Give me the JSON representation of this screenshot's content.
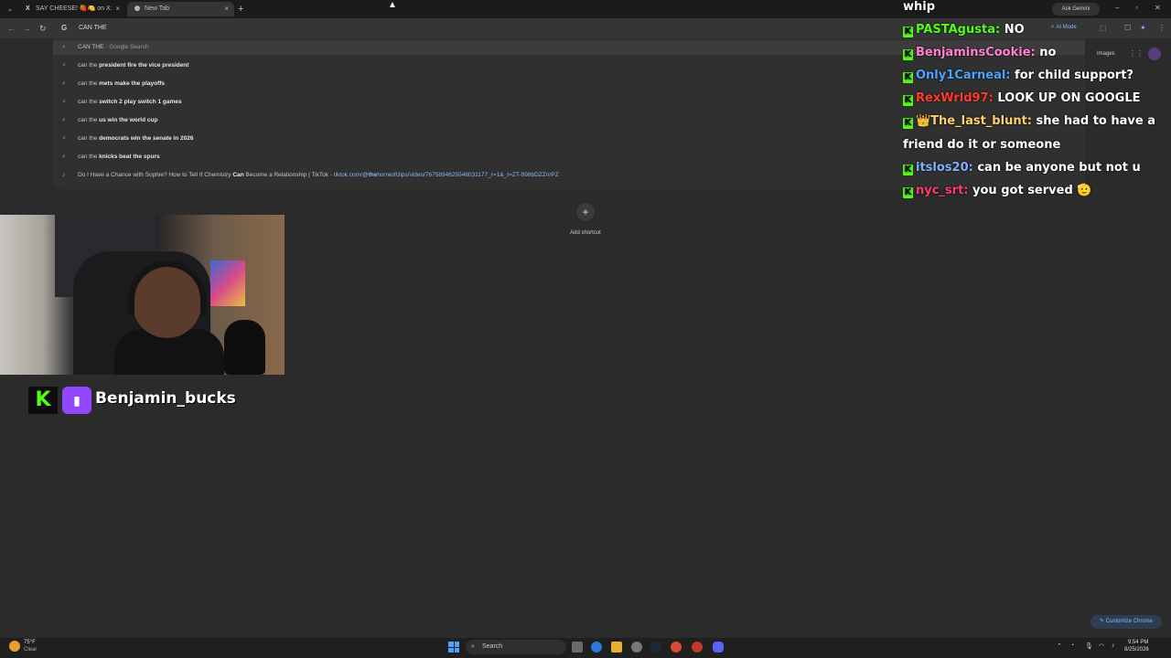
{
  "browser": {
    "tabs": [
      {
        "label": "SAY CHEESE! 🍓🍋 on X: \"Anti",
        "icon": "X",
        "active": false
      },
      {
        "label": "New Tab",
        "icon": "◍",
        "active": true
      }
    ],
    "ask_gemini": "Ask Gemini",
    "omnibox": {
      "text": "CAN THE",
      "ai_mode": "AI Mode"
    },
    "suggestions": [
      {
        "prefix": "CAN THE",
        "bold": "",
        "suffix": " - Google Search",
        "type": "search"
      },
      {
        "prefix": "can the ",
        "bold": "president fire the vice president",
        "suffix": "",
        "type": "search"
      },
      {
        "prefix": "can the ",
        "bold": "mets make the playoffs",
        "suffix": "",
        "type": "search"
      },
      {
        "prefix": "can the ",
        "bold": "switch 2 play switch 1 games",
        "suffix": "",
        "type": "search"
      },
      {
        "prefix": "can the ",
        "bold": "us win the world cup",
        "suffix": "",
        "type": "search"
      },
      {
        "prefix": "can the ",
        "bold": "democrats win the senate in 2026",
        "suffix": "",
        "type": "search"
      },
      {
        "prefix": "can the ",
        "bold": "knicks beat the spurs",
        "suffix": "",
        "type": "search"
      }
    ],
    "tiktok_suggestion": {
      "title_a": "Do I Have a Chance with Sophie? How to Tell If Chemistry ",
      "title_bold": "Can",
      "title_b": " Become a Relationship | TikTok",
      "sep": " - ",
      "url_a": "tiktok.com/@",
      "url_bold": "the",
      "url_b": "horreofclips/video/7675894625546031177_r=1&_t=ZT-998bDZZnrPZ"
    },
    "images_link": "Images",
    "add_shortcut": "Add shortcut",
    "customize": "Customize Chrome"
  },
  "chat": [
    {
      "user": "",
      "text": "whip",
      "color": "#ffffff",
      "badge": false
    },
    {
      "user": "PASTAgusta:",
      "text": " NO",
      "color": "#53fc18",
      "badge": true
    },
    {
      "user": "BenjaminsCookie:",
      "text": " no",
      "color": "#ff7fd0",
      "badge": true
    },
    {
      "user": "Only1Carneal:",
      "text": " for child support?",
      "color": "#4fa3ff",
      "badge": true
    },
    {
      "user": "RexWrld97:",
      "text": " LOOK UP ON GOOGLE",
      "color": "#ff3b30",
      "badge": true
    },
    {
      "user": "👑The_last_blunt:",
      "text": " she had to have a",
      "color": "#ffcf6b",
      "badge": true
    },
    {
      "user": "",
      "text": "friend do it or someone",
      "color": "#ffffff",
      "badge": false
    },
    {
      "user": "itslos20:",
      "text": " can be anyone but not u",
      "color": "#7fb0ff",
      "badge": true
    },
    {
      "user": "nyc_srt:",
      "text": " you got served 🫡",
      "color": "#ff3b6b",
      "badge": true
    }
  ],
  "streamer": {
    "name": "Benjamin_bucks",
    "kick": "K",
    "twitch": "▮"
  },
  "taskbar": {
    "weather_temp": "75°F",
    "weather_cond": "Clear",
    "search": "Search",
    "time": "9:54 PM",
    "date": "8/25/2026"
  },
  "colors": {
    "kick": "#53fc18",
    "twitch": "#9146ff",
    "link": "#8ab4f8"
  }
}
